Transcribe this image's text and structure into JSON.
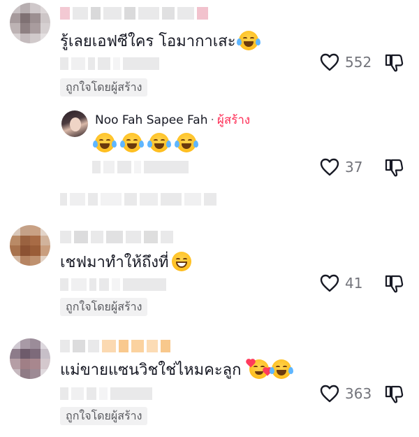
{
  "comments": [
    {
      "text": "รู้เลยเอฟซีใคร โอมากาเสะ",
      "emoji": [
        "joy"
      ],
      "likes": "552",
      "liked_by_creator": "ถูกใจโดยผู้สร้าง",
      "reply": {
        "author": "Noo Fah Sapee Fah",
        "separator": "·",
        "badge": "ผู้สร้าง",
        "emoji": [
          "joy",
          "joy",
          "joy",
          "joy"
        ],
        "likes": "37"
      }
    },
    {
      "text": "เชฟมาทำให้ถึงที่",
      "emoji": [
        "grin"
      ],
      "likes": "41",
      "liked_by_creator": "ถูกใจโดยผู้สร้าง"
    },
    {
      "text": "แม่ขายแซนวิชใช่ไหมคะลูก",
      "emoji": [
        "smiling-face-with-hearts",
        "joy"
      ],
      "likes": "363",
      "liked_by_creator": "ถูกใจโดยผู้สร้าง"
    }
  ],
  "icons": {
    "like": "heart-outline-icon",
    "dislike": "thumbs-down-icon"
  },
  "colors": {
    "creator_badge": "#fe2c55",
    "count_text": "#73747b",
    "tag_bg": "#f1f1f2"
  }
}
